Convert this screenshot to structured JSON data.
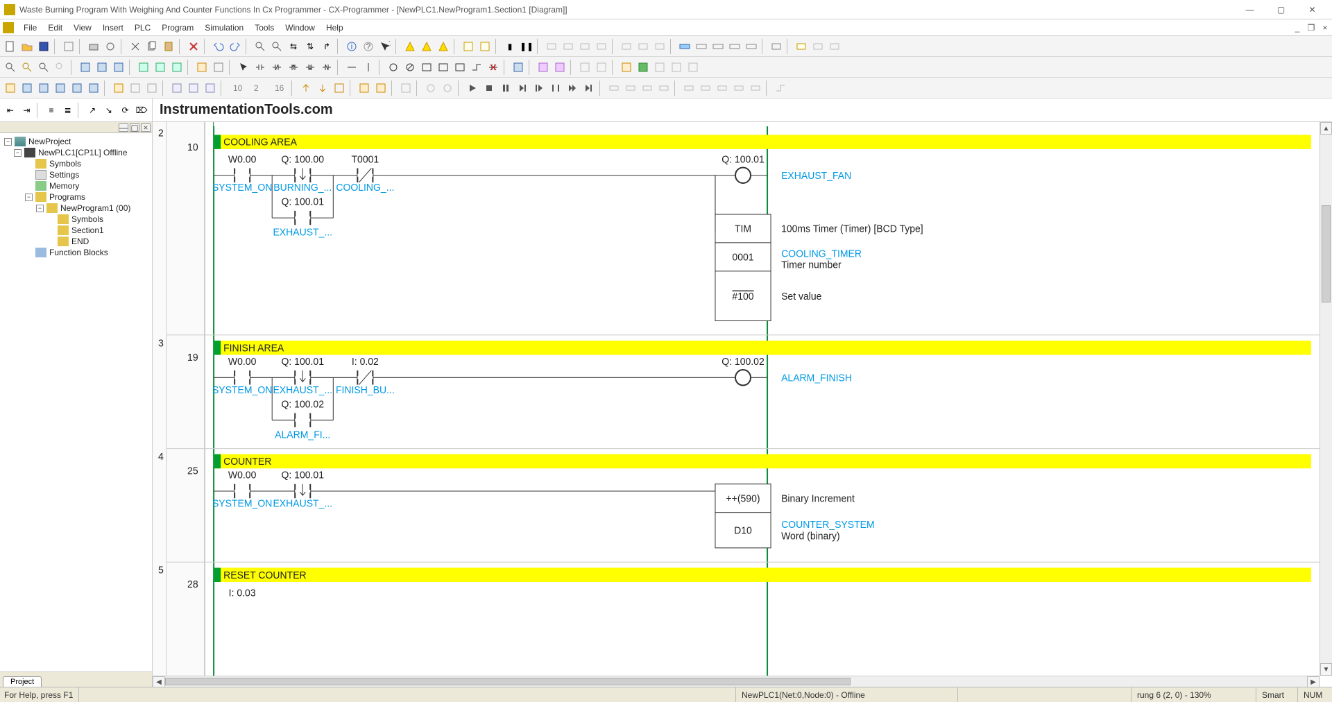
{
  "title": "Waste Burning Program With Weighing And Counter Functions In Cx Programmer - CX-Programmer - [NewPLC1.NewProgram1.Section1 [Diagram]]",
  "menu": [
    "File",
    "Edit",
    "View",
    "Insert",
    "PLC",
    "Program",
    "Simulation",
    "Tools",
    "Window",
    "Help"
  ],
  "watermark": "InstrumentationTools.com",
  "tree": {
    "root": "NewProject",
    "plc": "NewPLC1[CP1L] Offline",
    "symbols": "Symbols",
    "settings": "Settings",
    "memory": "Memory",
    "programs": "Programs",
    "program1": "NewProgram1 (00)",
    "p1symbols": "Symbols",
    "section1": "Section1",
    "end": "END",
    "fblocks": "Function Blocks"
  },
  "tab": "Project",
  "rung2": {
    "no": "2",
    "sub": "10",
    "title": "COOLING AREA",
    "c1a": "W0.00",
    "c1l": "SYSTEM_ON",
    "c2a": "Q: 100.00",
    "c2l": "BURNING_...",
    "c3a": "T0001",
    "c3l": "COOLING_...",
    "o1a": "Q: 100.01",
    "o1l": "EXHAUST_FAN",
    "b2a": "Q: 100.01",
    "b2l": "EXHAUST_...",
    "box1": "TIM",
    "box1ann": "100ms Timer (Timer) [BCD Type]",
    "box2": "0001",
    "box2l": "COOLING_TIMER",
    "box2ann": "Timer number",
    "box3": "#100",
    "box3ann": "Set value"
  },
  "rung3": {
    "no": "3",
    "sub": "19",
    "title": "FINISH AREA",
    "c1a": "W0.00",
    "c1l": "SYSTEM_ON",
    "c2a": "Q: 100.01",
    "c2l": "EXHAUST_...",
    "c3a": "I: 0.02",
    "c3l": "FINISH_BU...",
    "o1a": "Q: 100.02",
    "o1l": "ALARM_FINISH",
    "b2a": "Q: 100.02",
    "b2l": "ALARM_FI..."
  },
  "rung4": {
    "no": "4",
    "sub": "25",
    "title": "COUNTER",
    "c1a": "W0.00",
    "c1l": "SYSTEM_ON",
    "c2a": "Q: 100.01",
    "c2l": "EXHAUST_...",
    "box1": "++(590)",
    "box1ann": "Binary Increment",
    "box2": "D10",
    "box2l": "COUNTER_SYSTEM",
    "box2ann": "Word (binary)"
  },
  "rung5": {
    "no": "5",
    "sub": "28",
    "title": "RESET COUNTER",
    "c1a": "I: 0.03"
  },
  "status": {
    "help": "For Help, press F1",
    "conn": "NewPLC1(Net:0,Node:0) - Offline",
    "pos": "rung 6 (2, 0) - 130%",
    "smart": "Smart",
    "num": "NUM"
  }
}
